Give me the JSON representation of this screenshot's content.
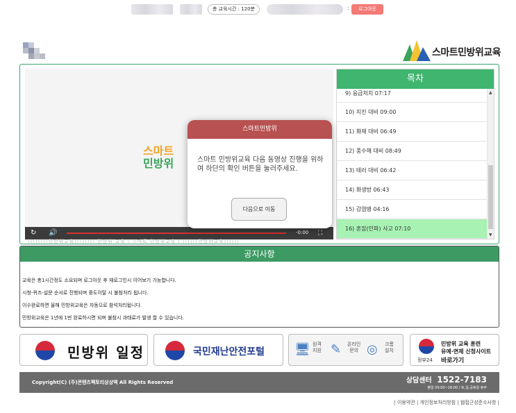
{
  "header": {
    "edu_time": "총 교육시간 : 120분",
    "colon": ":",
    "logout_label": "로그아웃"
  },
  "brand": {
    "name": "스마트민방위교육",
    "colors": {
      "green": "#3aa35c",
      "yellow": "#f2c230",
      "blue": "#2b5fb3"
    }
  },
  "video": {
    "logo_line1": "스마트",
    "logo_line2": "민방위",
    "time": "-0:00",
    "icons": [
      "replay-icon",
      "volume-icon",
      "fullscreen-icon"
    ]
  },
  "toc": {
    "title": "목차",
    "items": [
      {
        "label": "9) 응급처치 07:17"
      },
      {
        "label": "10) 지진 대비 09:00"
      },
      {
        "label": "11) 화재 대비 06:49"
      },
      {
        "label": "12) 풍수해 대비 08:49"
      },
      {
        "label": "13) 테러 대비 06:42"
      },
      {
        "label": "14) 화생방 06:43"
      },
      {
        "label": "15) 감염병 04:16"
      },
      {
        "label": "16) 혼잡(인파) 사고 07:10",
        "active": true
      }
    ]
  },
  "watermark": "((((((((민방위교육)))))))) 민방위 교육 | 스마트 민방위교육 | ((((((민방위교육))))))",
  "modal": {
    "title": "스마트민방위",
    "message": "스마트 민방위교육 다음 동영상 진행을 위하여 하단의 확인 버튼을 눌러주세요.",
    "button": "다음으로 이동"
  },
  "notice": {
    "title": "공지사항",
    "items": [
      "교육은 총1시간정도 소요되며 로그아웃 후 재로그인시 이어보기 가능합니다.",
      "시청-퀴즈-설문 순서로 진행되며 중도이탈 시 불참처리 됩니다.",
      "이수완료하면 올해 민방위교육은 자동으로 참석처리됩니다.",
      "민방위교육은 1년에 1번 완료하시면 되며 불참시 과태료가 발생 할 수 있습니다."
    ]
  },
  "banners": {
    "schedule": "민방위 일정",
    "portal": "국민재난안전포털",
    "remote": "원격 지원",
    "online_line1": "온라인",
    "online_line2": "문의",
    "chrome_line1": "크롬",
    "chrome_line2": "설치",
    "remote_line1": "원격",
    "remote_line2": "지원",
    "gov_line1": "민방위 교육 훈련",
    "gov_line2": "유예·면제 신청사이트",
    "gov_line3": "바로가기",
    "gov_label": "정부24"
  },
  "footer": {
    "copyright": "Copyright(C) (주)콘텐츠팩토리상상액 All Rights Reserved",
    "cs_label": "상담센터",
    "cs_phone": "1522-7183",
    "cs_hours": "평일 09:00~18:00 / 토,일,공휴일 휴무",
    "links": "| 이용약관 | 개인정보처리방침 | 웹접근성준수사항 |"
  }
}
